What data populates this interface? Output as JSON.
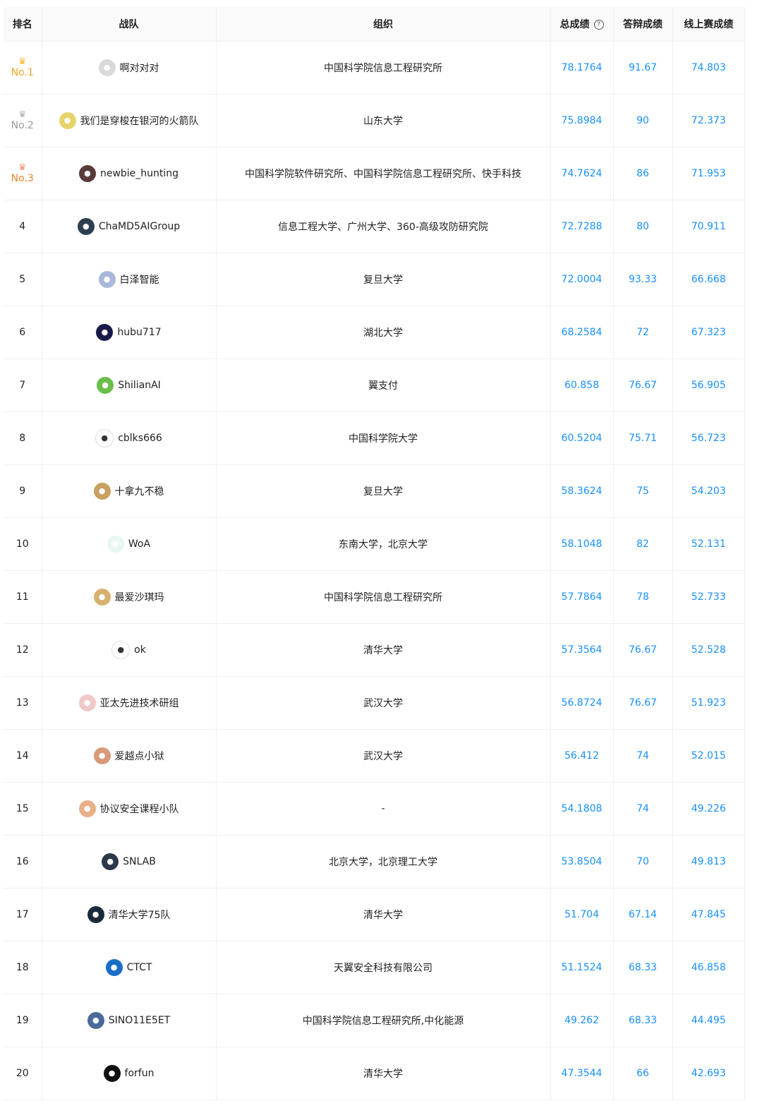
{
  "header": {
    "rank": "排名",
    "team": "战队",
    "org": "组织",
    "total": "总成绩",
    "defense": "答辩成绩",
    "online": "线上赛成绩"
  },
  "rows": [
    {
      "rank": "No.1",
      "medal": "gold",
      "team": "啊对对对",
      "avatar_color": "#d9d9d9",
      "org": "中国科学院信息工程研究所",
      "total": "78.1764",
      "defense": "91.67",
      "online": "74.803"
    },
    {
      "rank": "No.2",
      "medal": "silver",
      "team": "我们是穿梭在银河的火箭队",
      "avatar_color": "#e8d36b",
      "org": "山东大学",
      "total": "75.8984",
      "defense": "90",
      "online": "72.373"
    },
    {
      "rank": "No.3",
      "medal": "bronze",
      "team": "newbie_hunting",
      "avatar_color": "#5a3a3a",
      "org": "中国科学院软件研究所、中国科学院信息工程研究所、快手科技",
      "total": "74.7624",
      "defense": "86",
      "online": "71.953"
    },
    {
      "rank": "4",
      "team": "ChaMD5AIGroup",
      "avatar_color": "#2c3e50",
      "org": "信息工程大学、广州大学、360-高级攻防研究院",
      "total": "72.7288",
      "defense": "80",
      "online": "70.911"
    },
    {
      "rank": "5",
      "team": "白泽智能",
      "avatar_color": "#a8b8d8",
      "org": "复旦大学",
      "total": "72.0004",
      "defense": "93.33",
      "online": "66.668"
    },
    {
      "rank": "6",
      "team": "hubu717",
      "avatar_color": "#1a1a4a",
      "org": "湖北大学",
      "total": "68.2584",
      "defense": "72",
      "online": "67.323"
    },
    {
      "rank": "7",
      "team": "ShilianAI",
      "avatar_color": "#6abf4b",
      "org": "翼支付",
      "total": "60.858",
      "defense": "76.67",
      "online": "56.905"
    },
    {
      "rank": "8",
      "team": "cblks666",
      "avatar_color": "#ffffff",
      "org": "中国科学院大学",
      "total": "60.5204",
      "defense": "75.71",
      "online": "56.723"
    },
    {
      "rank": "9",
      "team": "十拿九不稳",
      "avatar_color": "#c8a060",
      "org": "复旦大学",
      "total": "58.3624",
      "defense": "75",
      "online": "54.203"
    },
    {
      "rank": "10",
      "team": "WoA",
      "avatar_color": "#e8f6f4",
      "org": "东南大学，北京大学",
      "total": "58.1048",
      "defense": "82",
      "online": "52.131"
    },
    {
      "rank": "11",
      "team": "最爱沙琪玛",
      "avatar_color": "#d8b070",
      "org": "中国科学院信息工程研究所",
      "total": "57.7864",
      "defense": "78",
      "online": "52.733"
    },
    {
      "rank": "12",
      "team": "ok",
      "avatar_color": "#ffffff",
      "org": "清华大学",
      "total": "57.3564",
      "defense": "76.67",
      "online": "52.528"
    },
    {
      "rank": "13",
      "team": "亚太先进技术研组",
      "avatar_color": "#f0c8c8",
      "org": "武汉大学",
      "total": "56.8724",
      "defense": "76.67",
      "online": "51.923"
    },
    {
      "rank": "14",
      "team": "爱越点小狱",
      "avatar_color": "#d89a7a",
      "org": "武汉大学",
      "total": "56.412",
      "defense": "74",
      "online": "52.015"
    },
    {
      "rank": "15",
      "team": "协议安全课程小队",
      "avatar_color": "#e8b088",
      "org": "-",
      "total": "54.1808",
      "defense": "74",
      "online": "49.226"
    },
    {
      "rank": "16",
      "team": "SNLAB",
      "avatar_color": "#2a3a4a",
      "org": "北京大学，北京理工大学",
      "total": "53.8504",
      "defense": "70",
      "online": "49.813"
    },
    {
      "rank": "17",
      "team": "清华大学75队",
      "avatar_color": "#1a2a3a",
      "org": "清华大学",
      "total": "51.704",
      "defense": "67.14",
      "online": "47.845"
    },
    {
      "rank": "18",
      "team": "CTCT",
      "avatar_color": "#1a6ec8",
      "org": "天翼安全科技有限公司",
      "total": "51.1524",
      "defense": "68.33",
      "online": "46.858"
    },
    {
      "rank": "19",
      "team": "SINO11E5ET",
      "avatar_color": "#4a6a9a",
      "org": "中国科学院信息工程研究所,中化能源",
      "total": "49.262",
      "defense": "68.33",
      "online": "44.495"
    },
    {
      "rank": "20",
      "team": "forfun",
      "avatar_color": "#111111",
      "org": "清华大学",
      "total": "47.3544",
      "defense": "66",
      "online": "42.693"
    }
  ]
}
